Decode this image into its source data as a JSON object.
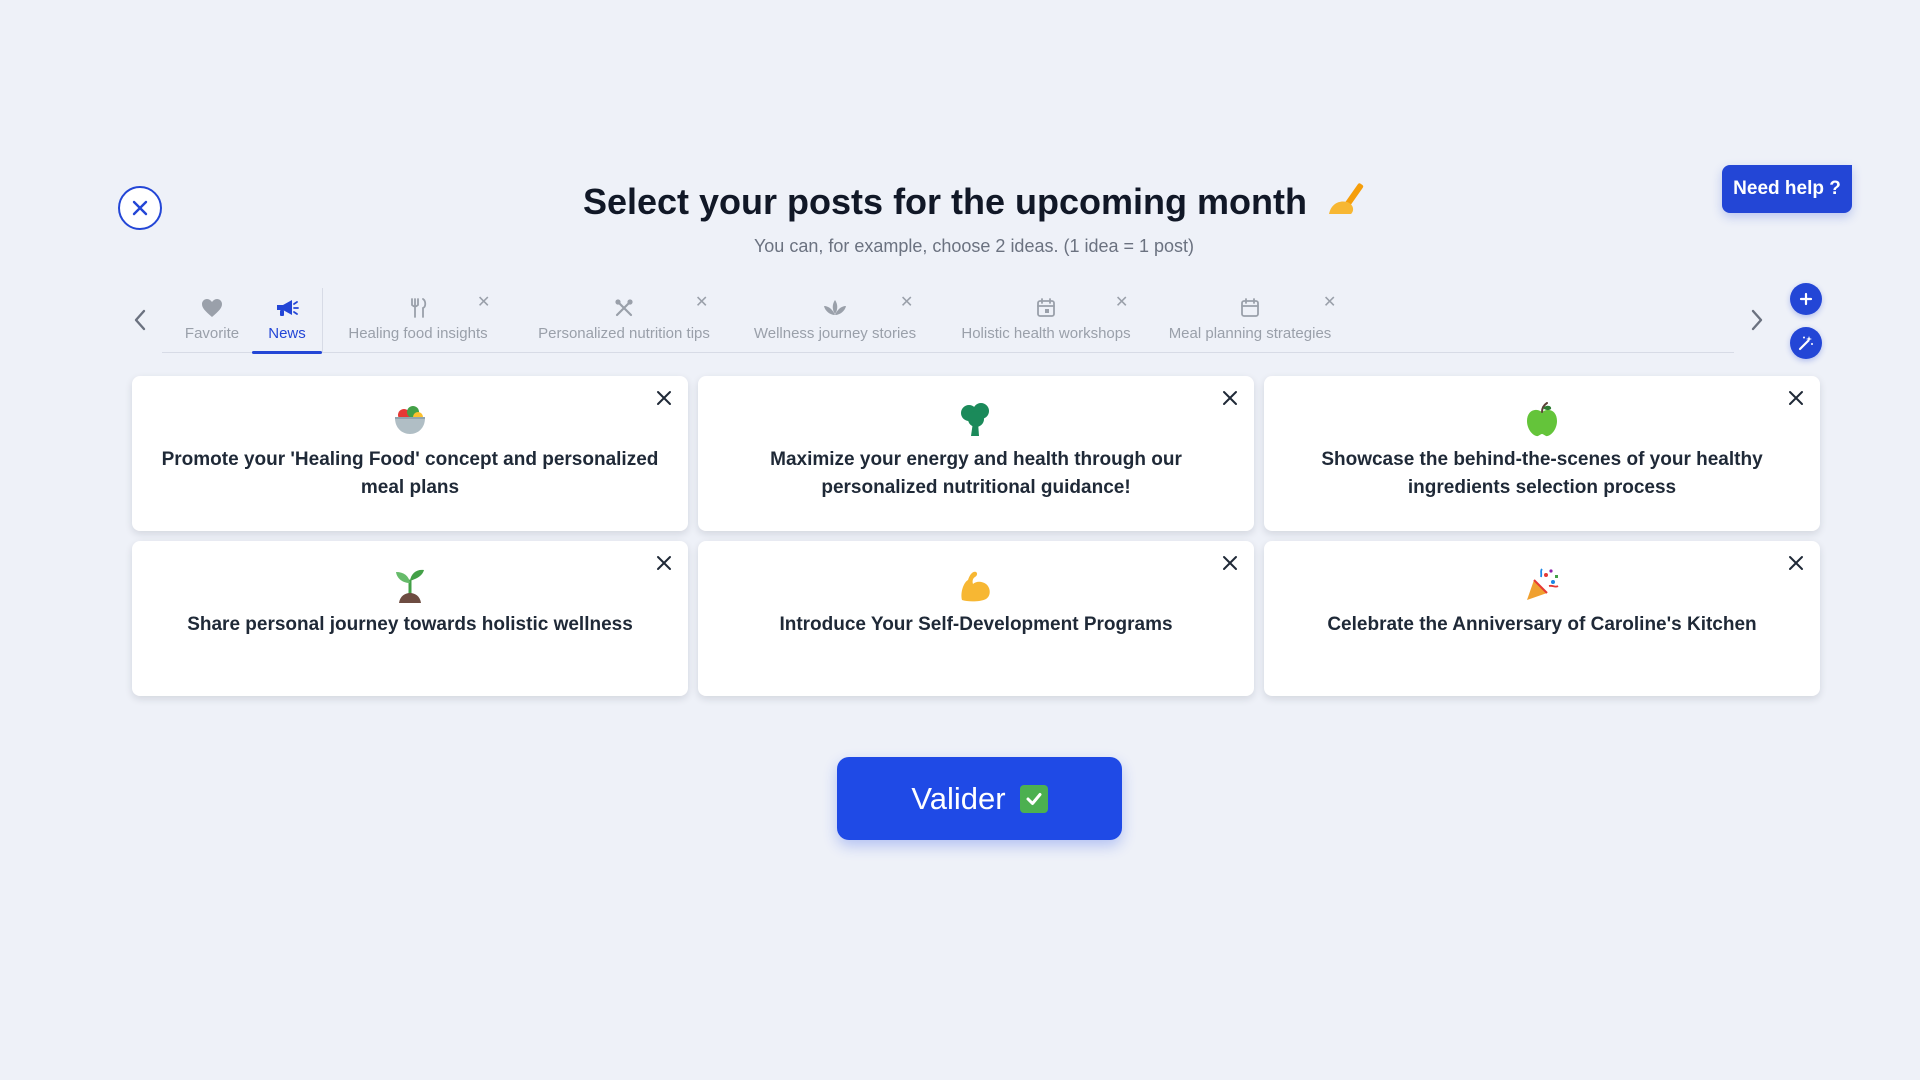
{
  "header": {
    "title": "Select your posts for the upcoming month",
    "title_emoji": "writing-hand",
    "subtitle": "You can, for example, choose 2 ideas. (1 idea = 1 post)",
    "help_label": "Need help ?"
  },
  "tabs": [
    {
      "label": "Favorite",
      "icon": "heart-icon",
      "active": false,
      "closable": false
    },
    {
      "label": "News",
      "icon": "megaphone-icon",
      "active": true,
      "closable": false
    },
    {
      "label": "Healing food insights",
      "icon": "fork-knife-icon",
      "active": false,
      "closable": true
    },
    {
      "label": "Personalized nutrition tips",
      "icon": "utensils-cross-icon",
      "active": false,
      "closable": true
    },
    {
      "label": "Wellness journey stories",
      "icon": "lotus-icon",
      "active": false,
      "closable": true
    },
    {
      "label": "Holistic health workshops",
      "icon": "calendar-icon",
      "active": false,
      "closable": true
    },
    {
      "label": "Meal planning strategies",
      "icon": "calendar-icon",
      "active": false,
      "closable": true
    }
  ],
  "ideas": [
    {
      "text": "Promote your 'Healing Food' concept and personalized meal plans",
      "icon": "salad-bowl-icon"
    },
    {
      "text": "Maximize your energy and health through our personalized nutritional guidance!",
      "icon": "broccoli-icon"
    },
    {
      "text": "Showcase the behind-the-scenes of your healthy ingredients selection process",
      "icon": "green-apple-icon"
    },
    {
      "text": "Share personal journey towards holistic wellness",
      "icon": "seedling-icon"
    },
    {
      "text": "Introduce Your Self-Development Programs",
      "icon": "flexed-biceps-icon"
    },
    {
      "text": "Celebrate the Anniversary of Caroline's Kitchen",
      "icon": "party-popper-icon"
    }
  ],
  "validate_label": "Valider",
  "colors": {
    "accent": "#2346d6",
    "background": "#eef1f8",
    "validate": "#1f4ae6",
    "check": "#4cb050"
  }
}
